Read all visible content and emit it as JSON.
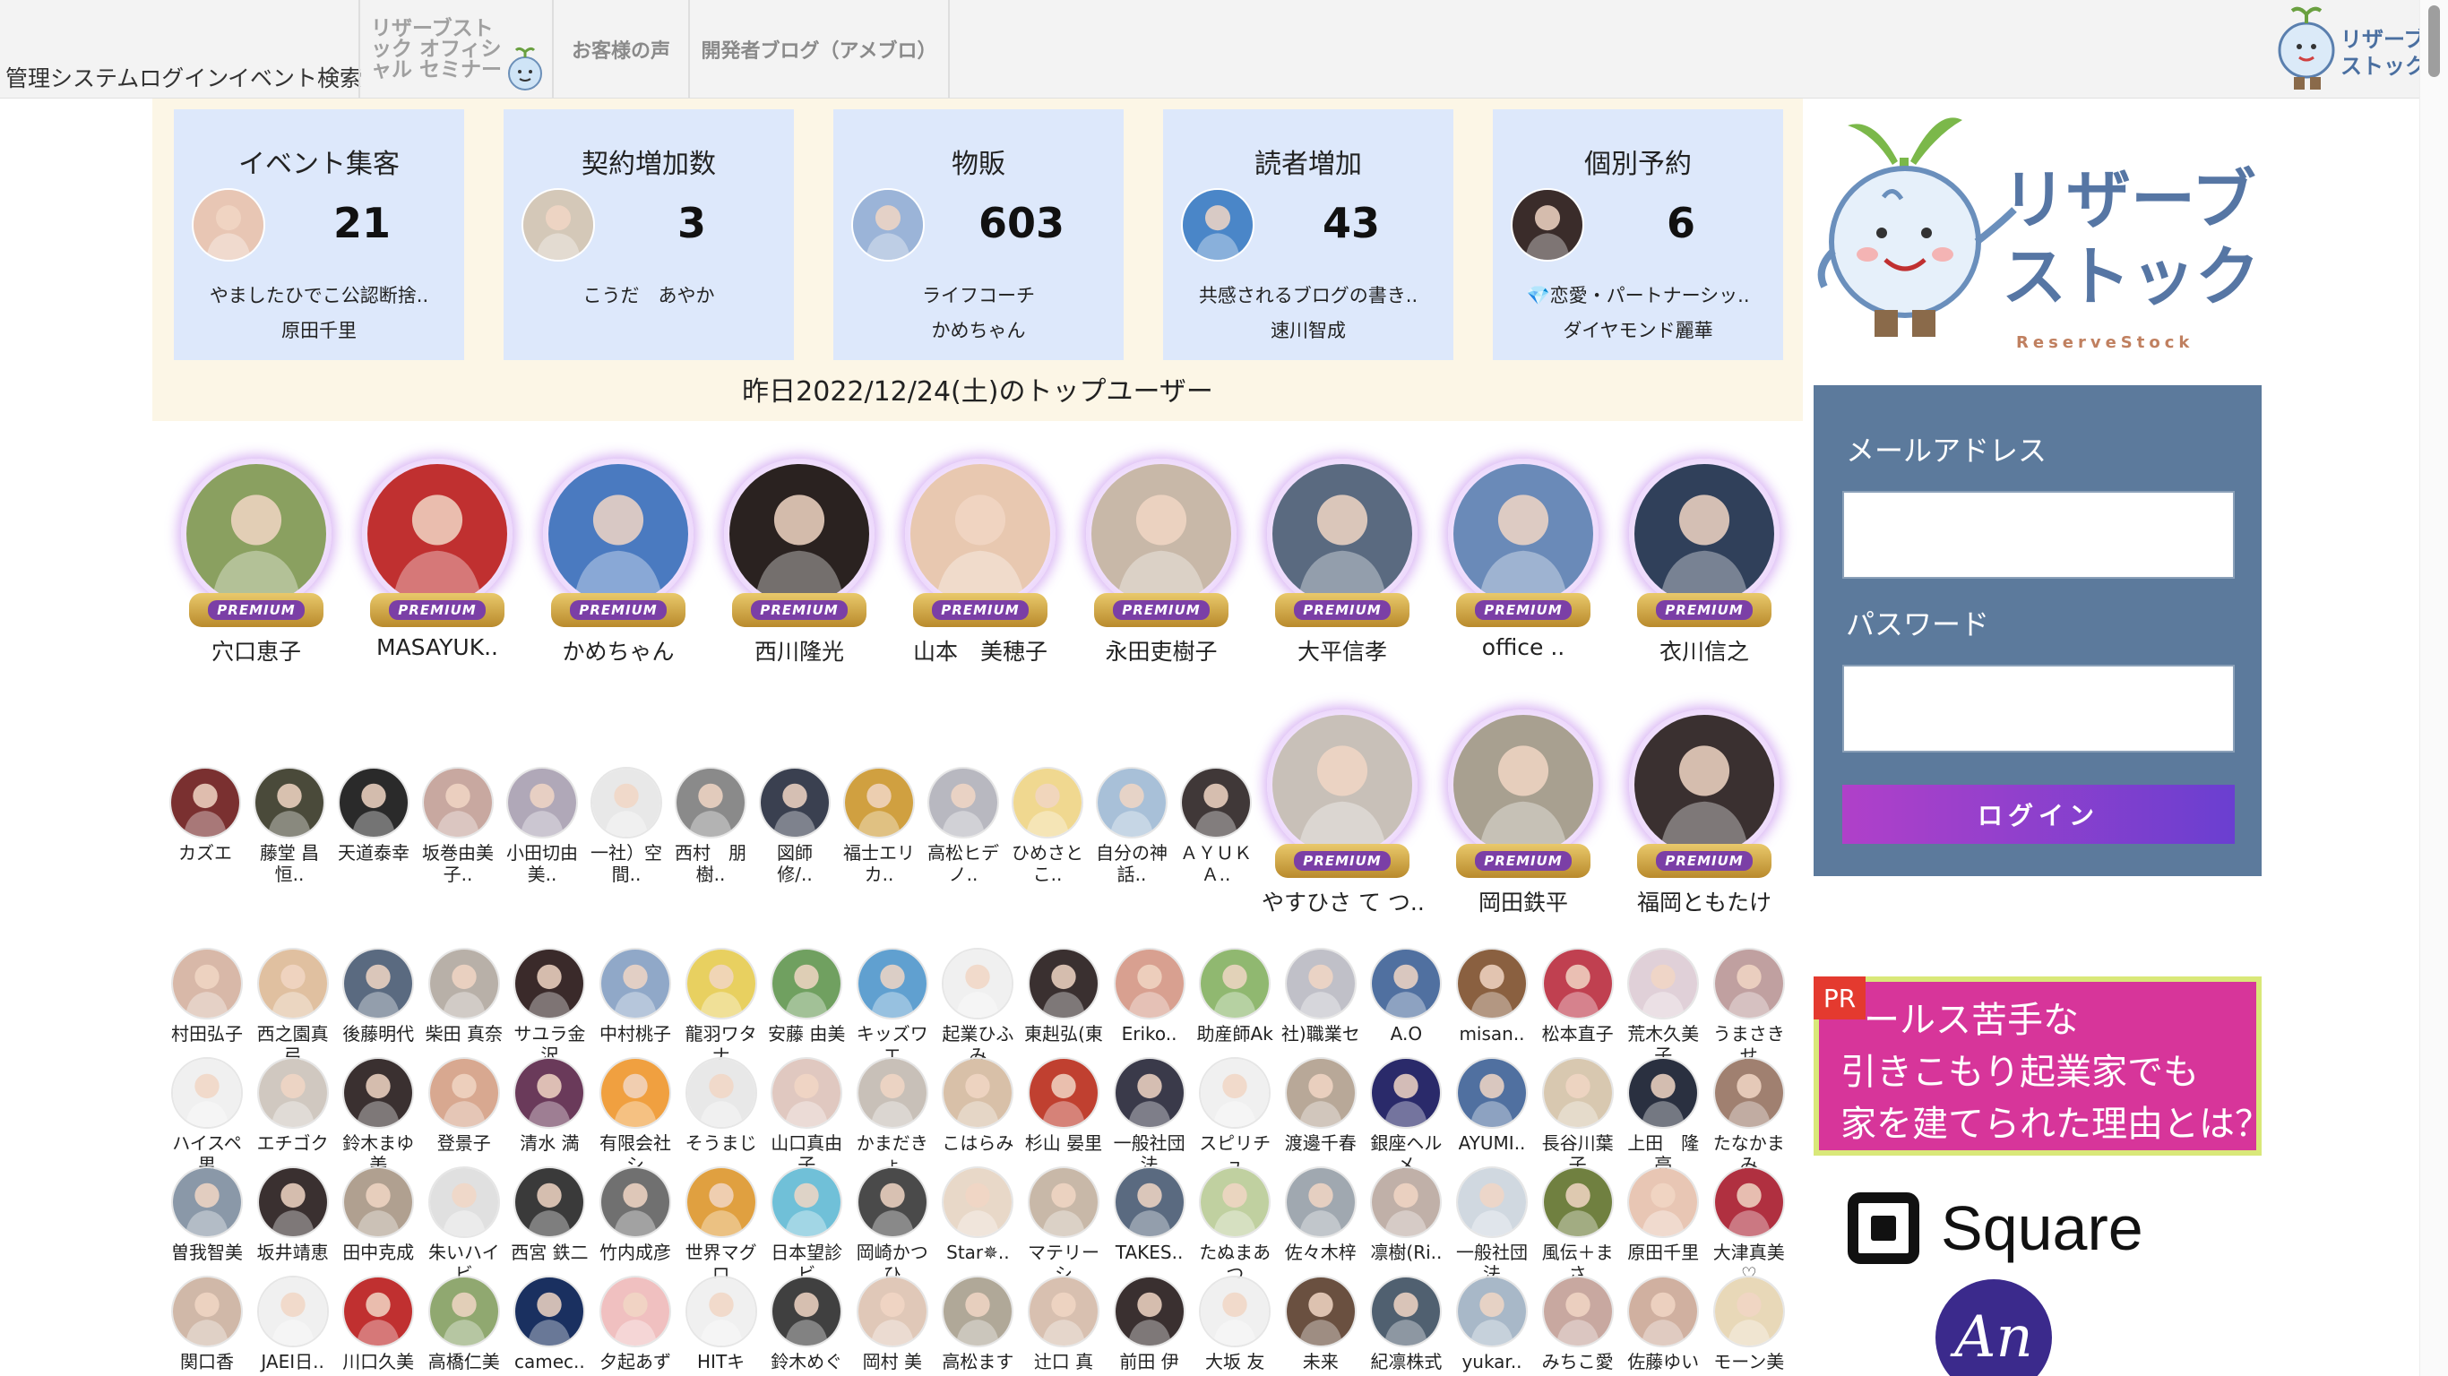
{
  "nav": {
    "admin_login": "管理システムログイン",
    "event_search": "イベント検索",
    "seminar": "リザーブストック オフィシャル セミナー",
    "voices": "お客様の声",
    "blog": "開発者ブログ（アメブロ）",
    "logo_text": "リザーブストック"
  },
  "top_cards": [
    {
      "title": "イベント集客",
      "count": "21",
      "line1": "やましたひでこ公認断捨..",
      "line2": "原田千里",
      "avatar_color": "#e8c6b4"
    },
    {
      "title": "契約増加数",
      "count": "3",
      "line1": "こうだ　あやか",
      "line2": "",
      "avatar_color": "#d4c8b8"
    },
    {
      "title": "物販",
      "count": "603",
      "line1": "ライフコーチ",
      "line2": "かめちゃん",
      "avatar_color": "#9bb4d8"
    },
    {
      "title": "読者増加",
      "count": "43",
      "line1": "共感されるブログの書き..",
      "line2": "速川智成",
      "avatar_color": "#4a86c8"
    },
    {
      "title": "個別予約",
      "count": "6",
      "line1": "💎恋愛・パートナーシッ..",
      "line2": "ダイヤモンド麗華",
      "avatar_color": "#3a2c2a"
    }
  ],
  "yesterday_label": "昨日2022/12/24(土)のトップユーザー",
  "premium_label": "PREMIUM",
  "premium_row1": [
    {
      "name": "穴口恵子",
      "color": "#8aa060"
    },
    {
      "name": "MASAYUK..",
      "color": "#c03030"
    },
    {
      "name": "かめちゃん",
      "color": "#4a7ac0"
    },
    {
      "name": "西川隆光",
      "color": "#2a2220"
    },
    {
      "name": "山本　美穂子",
      "color": "#e8c8b0"
    },
    {
      "name": "永田吏樹子",
      "color": "#c8b8a8"
    },
    {
      "name": "大平信孝",
      "color": "#5a6a80"
    },
    {
      "name": "office ..",
      "color": "#6a8ab8"
    },
    {
      "name": "衣川信之",
      "color": "#30405a"
    }
  ],
  "premium_row2": [
    {
      "name": "やすひさ て つ..",
      "color": "#c8c0b8"
    },
    {
      "name": "岡田鉄平",
      "color": "#a8a090"
    },
    {
      "name": "福岡ともたけ",
      "color": "#3a3030"
    }
  ],
  "small_row1": [
    {
      "name": "カズエ",
      "color": "#7a3030"
    },
    {
      "name": "藤堂 昌恒..",
      "color": "#4a4a3a"
    },
    {
      "name": "天道泰幸",
      "color": "#2a2a2a"
    },
    {
      "name": "坂巻由美子..",
      "color": "#c8a8a0"
    },
    {
      "name": "小田切由美..",
      "color": "#b0a8b8"
    },
    {
      "name": "一社）空間..",
      "color": "#e8e8e8"
    },
    {
      "name": "西村　朋樹..",
      "color": "#8a8a8a"
    },
    {
      "name": "図師　修/..",
      "color": "#3a4050"
    },
    {
      "name": "福士エリカ..",
      "color": "#d0a040"
    },
    {
      "name": "高松ヒデノ..",
      "color": "#b8b8c0"
    },
    {
      "name": "ひめさとこ..",
      "color": "#f0d890"
    },
    {
      "name": "自分の神話..",
      "color": "#a8c0d8"
    },
    {
      "name": "ＡＹＵＫＡ..",
      "color": "#403838"
    }
  ],
  "small_row2": [
    {
      "name": "村田弘子",
      "color": "#d8b8a8"
    },
    {
      "name": "西之園真弓",
      "color": "#e0c0a0"
    },
    {
      "name": "後藤明代",
      "color": "#5a6a80"
    },
    {
      "name": "柴田 真奈",
      "color": "#b8b0a8"
    },
    {
      "name": "サユラ金沢",
      "color": "#3a2a2a"
    },
    {
      "name": "中村桃子",
      "color": "#90a8c8"
    },
    {
      "name": "龍羽ワタナ",
      "color": "#e8d060"
    },
    {
      "name": "安藤 由美",
      "color": "#70a060"
    },
    {
      "name": "キッズワエ",
      "color": "#60a0d0"
    },
    {
      "name": "起業ひふみ",
      "color": "#f0f0f0"
    },
    {
      "name": "東赳弘(東",
      "color": "#3a3030"
    },
    {
      "name": "Eriko..",
      "color": "#d8a090"
    },
    {
      "name": "助産師Ak",
      "color": "#90b870"
    },
    {
      "name": "社)職業セ",
      "color": "#c0c0c8"
    },
    {
      "name": "A.O",
      "color": "#5070a0"
    },
    {
      "name": "misan..",
      "color": "#8a6040"
    },
    {
      "name": "松本直子",
      "color": "#c04050"
    },
    {
      "name": "荒木久美子",
      "color": "#e0d0d8"
    },
    {
      "name": "うまさきせ",
      "color": "#c0a0a0"
    }
  ],
  "small_row3": [
    {
      "name": "ハイスペ男",
      "color": "#f0f0f0"
    },
    {
      "name": "エチゴク",
      "color": "#d0c8c0"
    },
    {
      "name": "鈴木まゆ美",
      "color": "#3a3030"
    },
    {
      "name": "登景子",
      "color": "#d8a890"
    },
    {
      "name": "清水 満",
      "color": "#6a3a5a"
    },
    {
      "name": "有限会社シ",
      "color": "#f0a040"
    },
    {
      "name": "そうまじ",
      "color": "#e8e8e8"
    },
    {
      "name": "山口真由子",
      "color": "#e0c8c0"
    },
    {
      "name": "かまだきょ",
      "color": "#c8c0b8"
    },
    {
      "name": "こはらみ",
      "color": "#d8c0a8"
    },
    {
      "name": "杉山 晏里",
      "color": "#c04030"
    },
    {
      "name": "一般社団法",
      "color": "#3a3a4a"
    },
    {
      "name": "スピリチュ",
      "color": "#f0f0f0"
    },
    {
      "name": "渡邊千春",
      "color": "#b8a898"
    },
    {
      "name": "銀座ヘルメ",
      "color": "#2a2a6a"
    },
    {
      "name": "AYUMI..",
      "color": "#5070a0"
    },
    {
      "name": "長谷川葉子",
      "color": "#d8c8b0"
    },
    {
      "name": "上田　隆亮",
      "color": "#2a3040"
    },
    {
      "name": "たなかまみ",
      "color": "#a08070"
    }
  ],
  "small_row4": [
    {
      "name": "曽我智美",
      "color": "#8a98a8"
    },
    {
      "name": "坂井靖恵",
      "color": "#3a3030"
    },
    {
      "name": "田中克成",
      "color": "#b0a090"
    },
    {
      "name": "朱いハイビ",
      "color": "#e0e0e0"
    },
    {
      "name": "西宮 鉄二",
      "color": "#3a3a3a"
    },
    {
      "name": "竹内成彦",
      "color": "#707070"
    },
    {
      "name": "世界マグロ",
      "color": "#e0a040"
    },
    {
      "name": "日本望診ビ",
      "color": "#70c0d8"
    },
    {
      "name": "岡崎かつひ",
      "color": "#4a4a4a"
    },
    {
      "name": "Star✵..",
      "color": "#e8d8c8"
    },
    {
      "name": "マテリーシ",
      "color": "#c8b8a8"
    },
    {
      "name": "TAKES..",
      "color": "#5a6a80"
    },
    {
      "name": "たぬまあつ",
      "color": "#c0d0a0"
    },
    {
      "name": "佐々木梓",
      "color": "#a0a8b0"
    },
    {
      "name": "凛樹(Ri..",
      "color": "#c0b0a8"
    },
    {
      "name": "一般社団法",
      "color": "#d0d8e0"
    },
    {
      "name": "風伝＋まさ",
      "color": "#708040"
    },
    {
      "name": "原田千里",
      "color": "#e8c6b4"
    },
    {
      "name": "大津真美♡",
      "color": "#b03040"
    }
  ],
  "small_row5": [
    {
      "name": "関口香",
      "color": "#d0b8a8"
    },
    {
      "name": "JAEI日..",
      "color": "#f0f0f0"
    },
    {
      "name": "川口久美",
      "color": "#c03030"
    },
    {
      "name": "高橋仁美",
      "color": "#90a870"
    },
    {
      "name": "camec..",
      "color": "#1a3060"
    },
    {
      "name": "夕起あず",
      "color": "#f0c0c0"
    },
    {
      "name": "HITキ",
      "color": "#f0f0f0"
    },
    {
      "name": "鈴木めぐ",
      "color": "#404040"
    },
    {
      "name": "岡村 美",
      "color": "#e0c8b8"
    },
    {
      "name": "高松ます",
      "color": "#b0a898"
    },
    {
      "name": "辻口 真",
      "color": "#d8c0b0"
    },
    {
      "name": "前田 伊",
      "color": "#3a3030"
    },
    {
      "name": "大坂 友",
      "color": "#f0f0f0"
    },
    {
      "name": "未来",
      "color": "#6a5040"
    },
    {
      "name": "紀凛株式",
      "color": "#506070"
    },
    {
      "name": "yukar..",
      "color": "#a8b8c8"
    },
    {
      "name": "みちこ愛",
      "color": "#c8a8a0"
    },
    {
      "name": "佐藤ゆい",
      "color": "#d0b0a0"
    },
    {
      "name": "モーン美",
      "color": "#e8d8b8"
    }
  ],
  "login": {
    "email_label": "メールアドレス",
    "password_label": "パスワード",
    "button_label": "ログイン"
  },
  "pr": {
    "tag": "PR",
    "line1": "ールス苦手な",
    "line2": "引きこもり起業家でも",
    "line3": "家を建てられた理由とは？"
  },
  "big_logo": {
    "title1": "リザーブ",
    "title2": "ストック",
    "sub": "ReserveStock"
  },
  "square_text": "Square",
  "an_text": "An"
}
